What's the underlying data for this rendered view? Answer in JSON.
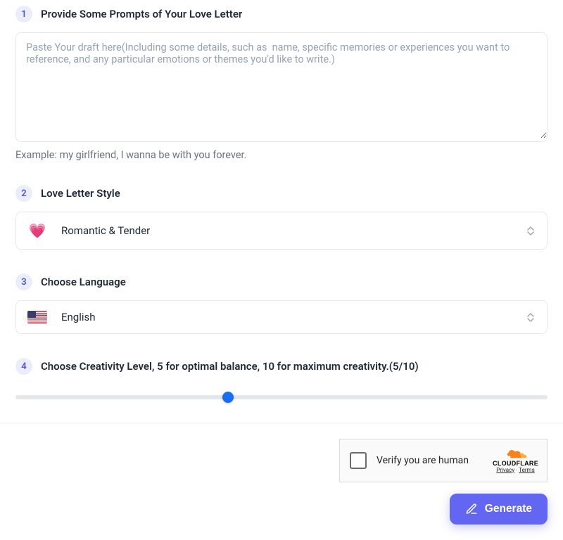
{
  "steps": {
    "s1": {
      "num": "1",
      "title": "Provide Some Prompts of Your Love Letter",
      "placeholder": "Paste Your draft here(Including some details, such as  name, specific memories or experiences you want to reference, and any particular emotions or themes you'd like to write.)",
      "value": "",
      "example": "Example:  my girlfriend, I wanna be with you forever."
    },
    "s2": {
      "num": "2",
      "title": "Love Letter Style",
      "icon": "💗",
      "selected": "Romantic & Tender"
    },
    "s3": {
      "num": "3",
      "title": "Choose Language",
      "selected": "English"
    },
    "s4": {
      "num": "4",
      "title": "Choose Creativity Level, 5 for optimal balance, 10 for maximum creativity.(5/10)",
      "value": 5,
      "min": 1,
      "max": 11
    }
  },
  "captcha": {
    "text": "Verify you are human",
    "brand": "CLOUDFLARE",
    "privacy": "Privacy",
    "terms": "Terms",
    "sep": "·"
  },
  "generate": {
    "label": "Generate"
  },
  "colors": {
    "accent": "#6366f1",
    "sliderThumb": "#1a6ef0"
  }
}
